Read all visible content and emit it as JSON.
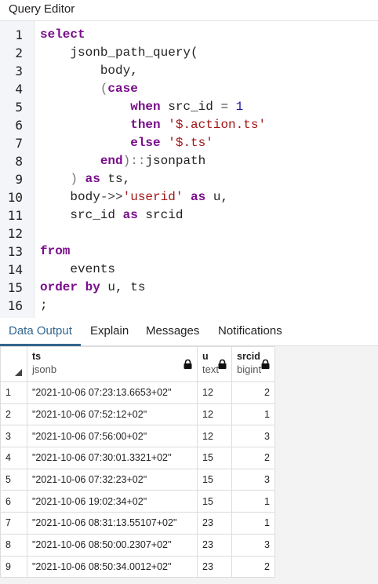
{
  "panel": {
    "title": "Query Editor"
  },
  "editor": {
    "lines": [
      {
        "n": "1",
        "tokens": [
          {
            "t": "select",
            "c": "kw"
          }
        ]
      },
      {
        "n": "2",
        "tokens": [
          {
            "t": "    jsonb_path_query(",
            "c": ""
          }
        ]
      },
      {
        "n": "3",
        "tokens": [
          {
            "t": "        body,",
            "c": ""
          }
        ]
      },
      {
        "n": "4",
        "tokens": [
          {
            "t": "        (",
            "c": "pun"
          },
          {
            "t": "case",
            "c": "kw"
          }
        ]
      },
      {
        "n": "5",
        "tokens": [
          {
            "t": "            ",
            "c": ""
          },
          {
            "t": "when",
            "c": "kw"
          },
          {
            "t": " src_id ",
            "c": ""
          },
          {
            "t": "=",
            "c": "op"
          },
          {
            "t": " ",
            "c": ""
          },
          {
            "t": "1",
            "c": "num"
          }
        ]
      },
      {
        "n": "6",
        "tokens": [
          {
            "t": "            ",
            "c": ""
          },
          {
            "t": "then",
            "c": "kw"
          },
          {
            "t": " ",
            "c": ""
          },
          {
            "t": "'$.action.ts'",
            "c": "str"
          }
        ]
      },
      {
        "n": "7",
        "tokens": [
          {
            "t": "            ",
            "c": ""
          },
          {
            "t": "else",
            "c": "kw"
          },
          {
            "t": " ",
            "c": ""
          },
          {
            "t": "'$.ts'",
            "c": "str"
          }
        ]
      },
      {
        "n": "8",
        "tokens": [
          {
            "t": "        ",
            "c": ""
          },
          {
            "t": "end",
            "c": "kw"
          },
          {
            "t": ")::",
            "c": "pun"
          },
          {
            "t": "jsonpath",
            "c": ""
          }
        ]
      },
      {
        "n": "9",
        "tokens": [
          {
            "t": "    ",
            "c": ""
          },
          {
            "t": ")",
            "c": "pun"
          },
          {
            "t": " ",
            "c": ""
          },
          {
            "t": "as",
            "c": "kw"
          },
          {
            "t": " ts,",
            "c": ""
          }
        ]
      },
      {
        "n": "10",
        "tokens": [
          {
            "t": "    body",
            "c": ""
          },
          {
            "t": "->>",
            "c": "op"
          },
          {
            "t": "'userid'",
            "c": "str"
          },
          {
            "t": " ",
            "c": ""
          },
          {
            "t": "as",
            "c": "kw"
          },
          {
            "t": " u,",
            "c": ""
          }
        ]
      },
      {
        "n": "11",
        "tokens": [
          {
            "t": "    src_id ",
            "c": ""
          },
          {
            "t": "as",
            "c": "kw"
          },
          {
            "t": " srcid",
            "c": ""
          }
        ]
      },
      {
        "n": "12",
        "tokens": []
      },
      {
        "n": "13",
        "tokens": [
          {
            "t": "from",
            "c": "kw"
          }
        ]
      },
      {
        "n": "14",
        "tokens": [
          {
            "t": "    events",
            "c": ""
          }
        ]
      },
      {
        "n": "15",
        "tokens": [
          {
            "t": "order by",
            "c": "kw"
          },
          {
            "t": " u, ts",
            "c": ""
          }
        ]
      },
      {
        "n": "16",
        "tokens": [
          {
            "t": ";",
            "c": ""
          }
        ]
      }
    ]
  },
  "tabs": [
    {
      "label": "Data Output",
      "active": true
    },
    {
      "label": "Explain",
      "active": false
    },
    {
      "label": "Messages",
      "active": false
    },
    {
      "label": "Notifications",
      "active": false
    }
  ],
  "grid": {
    "columns": [
      {
        "name": "ts",
        "type": "jsonb",
        "locked": true
      },
      {
        "name": "u",
        "type": "text",
        "locked": true
      },
      {
        "name": "srcid",
        "type": "bigint",
        "locked": true
      }
    ],
    "rows": [
      {
        "n": "1",
        "ts": "\"2021-10-06 07:23:13.6653+02\"",
        "u": "12",
        "srcid": "2"
      },
      {
        "n": "2",
        "ts": "\"2021-10-06 07:52:12+02\"",
        "u": "12",
        "srcid": "1"
      },
      {
        "n": "3",
        "ts": "\"2021-10-06 07:56:00+02\"",
        "u": "12",
        "srcid": "3"
      },
      {
        "n": "4",
        "ts": "\"2021-10-06 07:30:01.3321+02\"",
        "u": "15",
        "srcid": "2"
      },
      {
        "n": "5",
        "ts": "\"2021-10-06 07:32:23+02\"",
        "u": "15",
        "srcid": "3"
      },
      {
        "n": "6",
        "ts": "\"2021-10-06 19:02:34+02\"",
        "u": "15",
        "srcid": "1"
      },
      {
        "n": "7",
        "ts": "\"2021-10-06 08:31:13.55107+02\"",
        "u": "23",
        "srcid": "1"
      },
      {
        "n": "8",
        "ts": "\"2021-10-06 08:50:00.2307+02\"",
        "u": "23",
        "srcid": "3"
      },
      {
        "n": "9",
        "ts": "\"2021-10-06 08:50:34.0012+02\"",
        "u": "23",
        "srcid": "2"
      }
    ]
  },
  "icons": {
    "lock": "lock-icon",
    "sort": "select-all-corner-icon"
  },
  "colors": {
    "accent": "#326690",
    "keyword": "#7a0d8c",
    "string": "#a31515",
    "number": "#1a1aa6"
  }
}
